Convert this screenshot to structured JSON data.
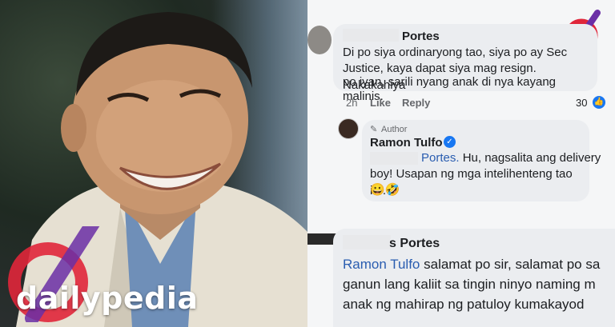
{
  "brand": {
    "name": "dailypedia"
  },
  "comment1": {
    "author": "Portes",
    "text_lines": [
      "Di po siya ordinaryong tao, siya po ay Sec",
      "Justice, kaya dapat siya mag resign. Nakakahiya",
      "po iyan, sarili nyang anak di nya kayang malinis."
    ],
    "time": "2h",
    "like_label": "Like",
    "reply_label": "Reply",
    "reaction_count": "30"
  },
  "reply": {
    "badge": "Author",
    "author": "Ramon Tulfo",
    "mention": "Portes.",
    "text_first": " Hu,  nagsalita ang delivery",
    "text_second": "boy! Usapan ng mga intelihenteng tao ito.",
    "emojis": "😀🤣"
  },
  "comment2": {
    "author": "s Portes",
    "mention": "Ramon Tulfo",
    "text_first": " salamat po sir, salamat po sa",
    "text_lines": [
      "ganun lang kaliit sa tingin ninyo naming m",
      "anak ng mahirap ng patuloy kumakayod"
    ]
  },
  "colors": {
    "accent_blue": "#2a5db0",
    "bubble": "#ebedf0",
    "reaction_blue": "#1877f2",
    "logo_red": "#e0263a",
    "logo_purple": "#6b2fa6"
  }
}
